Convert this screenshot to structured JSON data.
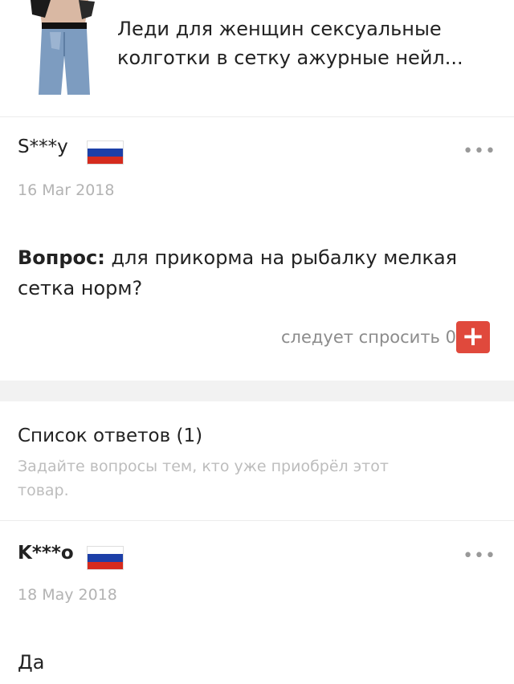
{
  "product": {
    "title": "Леди для женщин сексуальные колготки в сетку ажурные нейл..."
  },
  "question": {
    "author": "S***y",
    "date": "16 Mar 2018",
    "label": "Вопрос:",
    "text": " для прикорма на рыбалку мелкая сетка норм?",
    "helpful_label": "следует спросить",
    "helpful_count": "0",
    "plus_symbol": "+",
    "more_icon": "•••"
  },
  "answers": {
    "title": "Список ответов (1)",
    "hint": "Задайте вопросы тем, кто уже приобрёл этот товар.",
    "items": [
      {
        "author": "K***o",
        "date": "18 May 2018",
        "text": "Да",
        "more_icon": "•••"
      }
    ]
  },
  "colors": {
    "accent": "#e0493c",
    "flag_white": "#ffffff",
    "flag_blue": "#1c3fa8",
    "flag_red": "#d52b1e"
  }
}
